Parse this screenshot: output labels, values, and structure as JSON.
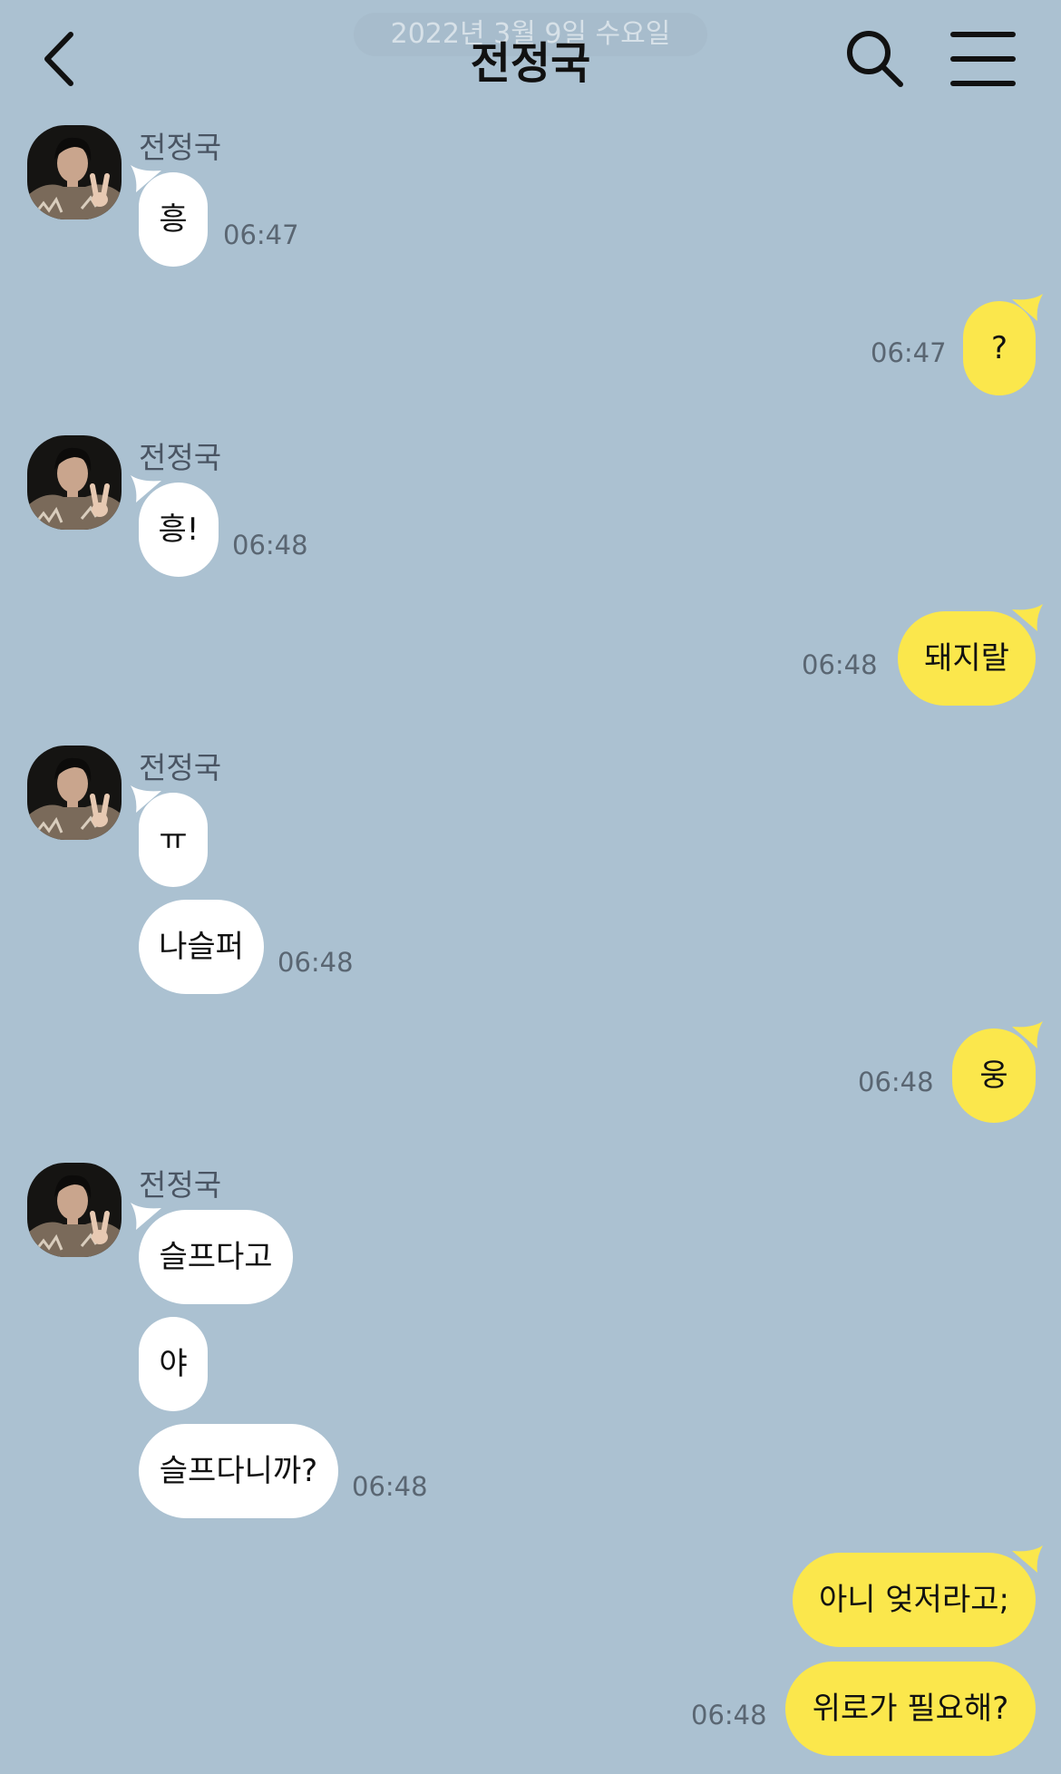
{
  "header": {
    "date_banner": "2022년 3월 9일 수요일",
    "title": "전정국"
  },
  "colors": {
    "background": "#abc1d1",
    "incoming_bubble": "#ffffff",
    "outgoing_bubble": "#fbe74c"
  },
  "icons": {
    "back": "chevron-left-icon",
    "search": "search-icon",
    "menu": "hamburger-menu-icon"
  },
  "groups": [
    {
      "sender": "전정국",
      "messages": [
        "흥"
      ],
      "time": "06:47"
    },
    {
      "me": true,
      "messages": [
        "?"
      ],
      "time": "06:47"
    },
    {
      "sender": "전정국",
      "messages": [
        "흥!"
      ],
      "time": "06:48"
    },
    {
      "me": true,
      "messages": [
        "돼지랄"
      ],
      "time": "06:48"
    },
    {
      "sender": "전정국",
      "messages": [
        "ㅠ",
        "나슬퍼"
      ],
      "time": "06:48"
    },
    {
      "me": true,
      "messages": [
        "웅"
      ],
      "time": "06:48"
    },
    {
      "sender": "전정국",
      "messages": [
        "슬프다고",
        "야",
        "슬프다니까?"
      ],
      "time": "06:48"
    },
    {
      "me": true,
      "messages": [
        "아니 엊저라고;",
        "위로가 필요해?"
      ],
      "time": "06:48"
    }
  ]
}
